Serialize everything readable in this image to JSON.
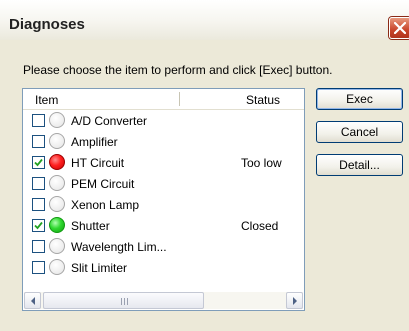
{
  "dialog": {
    "title": "Diagnoses",
    "prompt": "Please choose the item to perform and click [Exec] button."
  },
  "list": {
    "columns": {
      "item": "Item",
      "status": "Status"
    },
    "rows": [
      {
        "label": "A/D Converter",
        "checked": false,
        "indicator": "off",
        "status": ""
      },
      {
        "label": "Amplifier",
        "checked": false,
        "indicator": "off",
        "status": ""
      },
      {
        "label": "HT Circuit",
        "checked": true,
        "indicator": "red",
        "status": "Too low"
      },
      {
        "label": "PEM Circuit",
        "checked": false,
        "indicator": "off",
        "status": ""
      },
      {
        "label": "Xenon Lamp",
        "checked": false,
        "indicator": "off",
        "status": ""
      },
      {
        "label": "Shutter",
        "checked": true,
        "indicator": "green",
        "status": "Closed"
      },
      {
        "label": "Wavelength Lim...",
        "checked": false,
        "indicator": "off",
        "status": ""
      },
      {
        "label": "Slit Limiter",
        "checked": false,
        "indicator": "off",
        "status": ""
      }
    ]
  },
  "buttons": {
    "exec": "Exec",
    "cancel": "Cancel",
    "detail": "Detail..."
  },
  "icons": {
    "close": "close-icon",
    "scroll_left": "arrow-left-icon",
    "scroll_right": "arrow-right-icon"
  },
  "colors": {
    "indicator_red": "#ff2020",
    "indicator_green": "#30d830",
    "close_button": "#c8442a"
  }
}
